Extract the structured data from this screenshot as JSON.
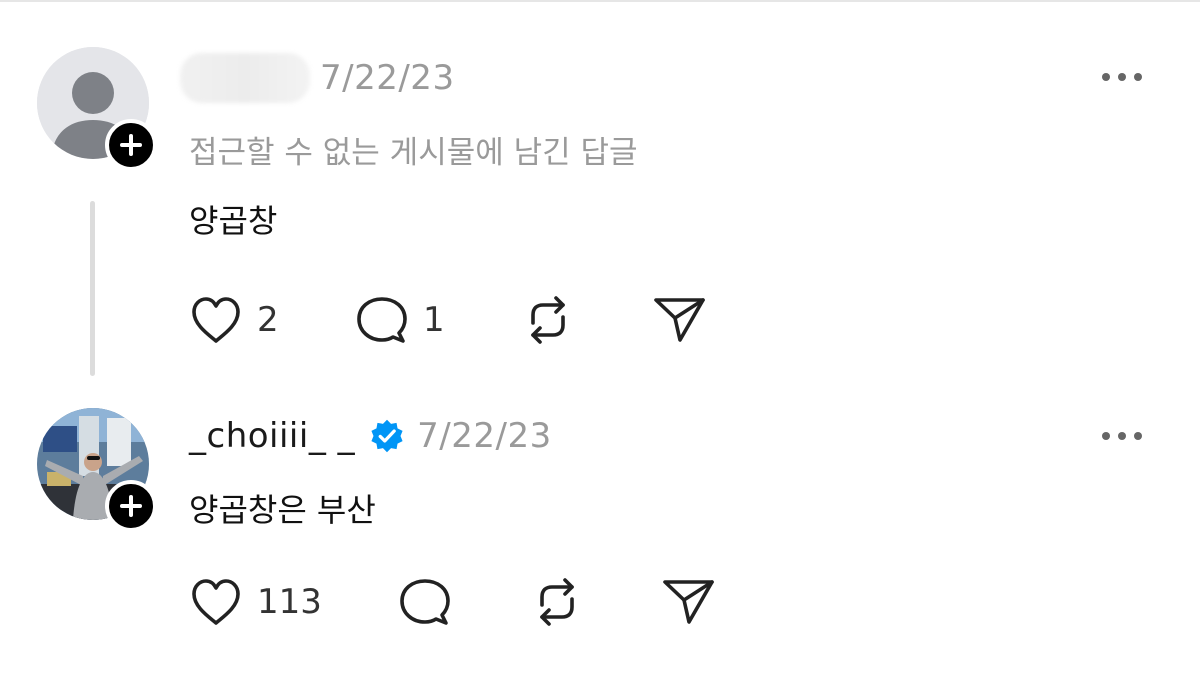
{
  "replies": [
    {
      "username": "",
      "timestamp": "7/22/23",
      "context_note": "접근할 수 없는 게시물에 남긴 답글",
      "text": "양곱창",
      "verified": false,
      "likes": "2",
      "comments": "1",
      "reposts": "",
      "avatar": "default-avatar"
    },
    {
      "username": "_choiiii_ _",
      "timestamp": "7/22/23",
      "text": "양곱창은 부산",
      "verified": true,
      "likes": "113",
      "comments": "",
      "reposts": "",
      "avatar": "user-photo"
    }
  ],
  "icons": {
    "like": "heart-icon",
    "comment": "comment-bubble-icon",
    "repost": "repost-icon",
    "share": "send-icon",
    "more": "more-dots-icon",
    "follow": "plus-icon",
    "verified": "verified-badge-icon"
  },
  "colors": {
    "verified": "#0095f6",
    "muted": "#9a9a9a",
    "thread_line": "#dcdcdc"
  }
}
